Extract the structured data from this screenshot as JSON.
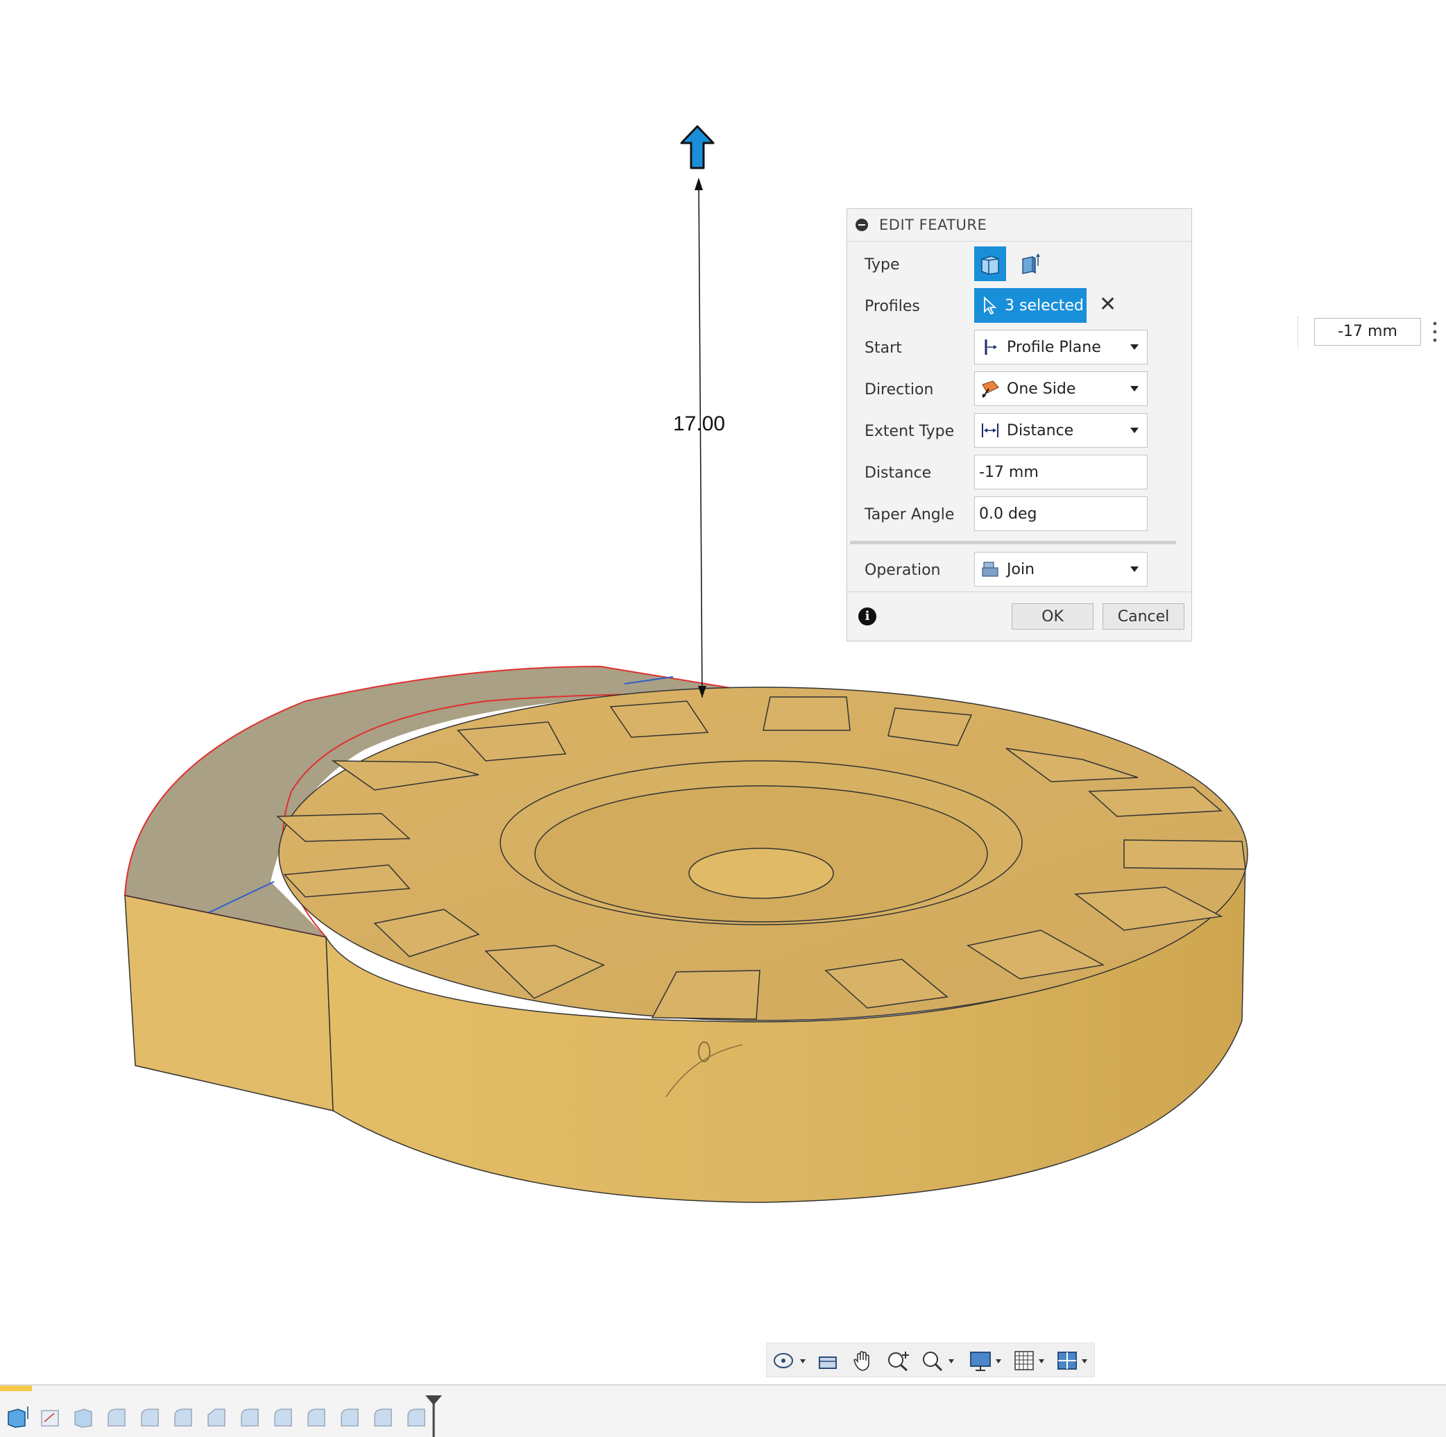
{
  "viewport": {
    "dimension_value": "17.00"
  },
  "edit_feature": {
    "title": "EDIT FEATURE",
    "type": {
      "label": "Type",
      "options": [
        "solid-extrude-icon",
        "thin-extrude-icon"
      ],
      "selected": "solid-extrude-icon"
    },
    "profiles": {
      "label": "Profiles",
      "value": "3 selected"
    },
    "start": {
      "label": "Start",
      "value": "Profile Plane"
    },
    "direction": {
      "label": "Direction",
      "value": "One Side"
    },
    "extent_type": {
      "label": "Extent Type",
      "value": "Distance"
    },
    "distance": {
      "label": "Distance",
      "value": "-17 mm"
    },
    "taper_angle": {
      "label": "Taper Angle",
      "value": "0.0 deg"
    },
    "operation": {
      "label": "Operation",
      "value": "Join"
    },
    "ok_label": "OK",
    "cancel_label": "Cancel"
  },
  "floating_input": {
    "value": "-17 mm"
  },
  "navbar": {
    "items": [
      "orbit-icon",
      "look-at-icon",
      "pan-icon",
      "zoom-icon",
      "fit-icon",
      "display-settings-icon",
      "grid-icon",
      "viewports-icon"
    ]
  },
  "colors": {
    "accent": "#1a8fd9",
    "part_fill": "#dcb765",
    "part_side": "#e0b962",
    "sketch_profile": "#a9a085",
    "selection_edge": "#e03030"
  }
}
